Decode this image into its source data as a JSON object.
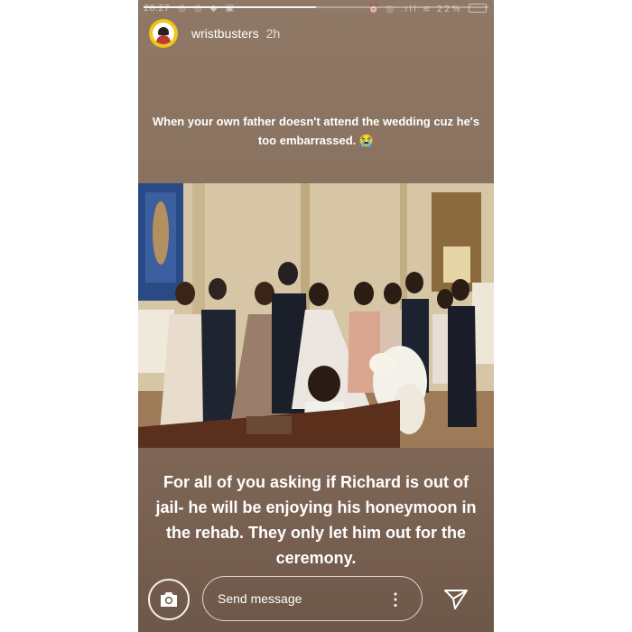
{
  "status_bar": {
    "time": "20:27",
    "left_icons": "◎ ◎ ◆ ▣",
    "right_icons": "⏰ ◎ .ıll ≋",
    "battery": "22%"
  },
  "story": {
    "progress_fraction": 0.5,
    "username": "wristbusters",
    "time_ago": "2h",
    "caption_top": "When your own father doesn't attend the wedding cuz he's too embarrassed. 😭",
    "caption_bottom": "For all of you asking if Richard is out of jail- he will be enjoying his honeymoon in the rehab. They only let him out for the ceremony."
  },
  "bottom_bar": {
    "camera_icon": "camera-icon",
    "placeholder": "Send message",
    "more_icon": "⋮",
    "share_icon": "send-icon"
  },
  "colors": {
    "background": "#876f5c",
    "text": "#ffffff"
  }
}
